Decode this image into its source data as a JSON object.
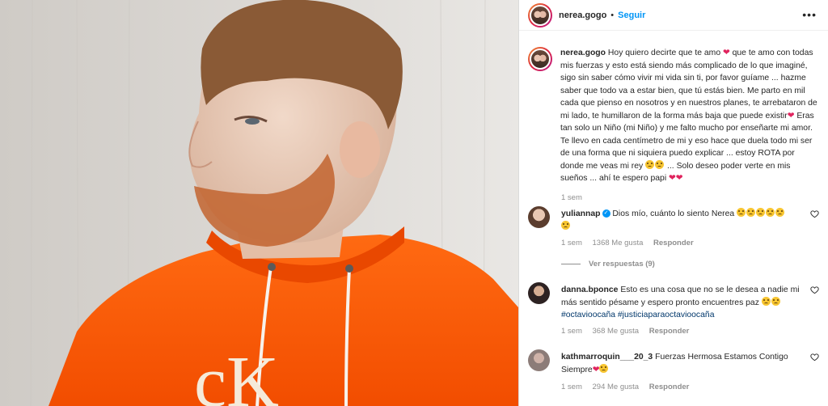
{
  "post": {
    "username": "nerea.gogo",
    "dot": "•",
    "follow_label": "Seguir",
    "more": "•••",
    "caption_parts": [
      "Hoy quiero decirte que te amo",
      "que te amo con todas mis fuerzas y esto está siendo más complicado de lo que imaginé, sigo sin saber cómo vivir mi vida sin ti, por favor guíame ... hazme saber que todo va a estar bien, que tú estás bien. Me parto en mil cada que pienso en nosotros y en nuestros planes, te arrebataron de mi lado, te humillaron de la forma más baja que puede existir",
      "Eras tan solo un Niño (mi Niño) y me falto mucho por enseñarte mi amor. Te llevo en cada centímetro de mi y eso hace que duela todo mi ser de una forma que ni siquiera puedo explicar ... estoy ROTA por donde me veas mi rey",
      "... Solo deseo poder verte en mis sueños ... ahí te espero papi"
    ],
    "time": "1 sem"
  },
  "comments": [
    {
      "username": "yuliannap",
      "verified": true,
      "text": "Dios mío, cuánto lo siento Nerea",
      "time": "1 sem",
      "likes": "1368 Me gusta",
      "reply": "Responder",
      "view_replies": "Ver respuestas (9)"
    },
    {
      "username": "danna.bponce",
      "text": "Esto es una cosa que no se le desea a nadie mi más sentido pésame y espero pronto encuentres paz",
      "hashtags": "#octavioocaña #justiciaparaoctavioocaña",
      "time": "1 sem",
      "likes": "368 Me gusta",
      "reply": "Responder"
    },
    {
      "username": "kathmarroquin___20_3",
      "text": "Fuerzas Hermosa Estamos Contigo Siempre",
      "time": "1 sem",
      "likes": "294 Me gusta",
      "reply": "Responder"
    }
  ],
  "photo": {
    "logo_text": "cK"
  },
  "colors": {
    "link": "#0095f6",
    "hoodie": "#ff5a0a",
    "wall": "#d8d6d2"
  }
}
